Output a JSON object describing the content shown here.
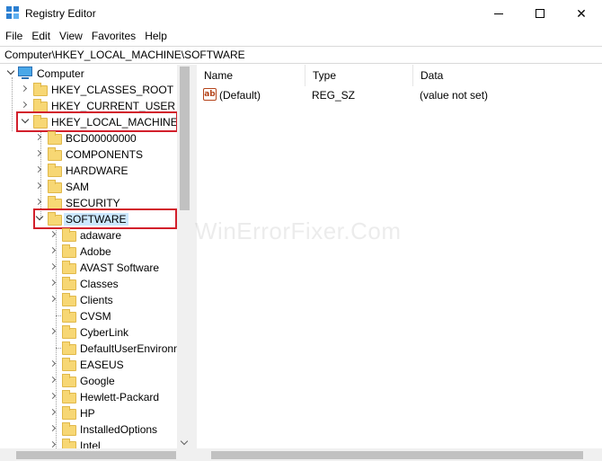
{
  "window": {
    "title": "Registry Editor",
    "icon": "registry-editor-icon",
    "controls": [
      "minimize-icon",
      "maximize-icon",
      "close-icon"
    ],
    "close_glyph": "✕"
  },
  "menu": {
    "items": [
      "File",
      "Edit",
      "View",
      "Favorites",
      "Help"
    ]
  },
  "address": {
    "path": "Computer\\HKEY_LOCAL_MACHINE\\SOFTWARE"
  },
  "tree": {
    "root": "Computer",
    "hives": [
      "HKEY_CLASSES_ROOT",
      "HKEY_CURRENT_USER",
      "HKEY_LOCAL_MACHINE"
    ],
    "hklm_children": [
      "BCD00000000",
      "COMPONENTS",
      "HARDWARE",
      "SAM",
      "SECURITY",
      "SOFTWARE"
    ],
    "software_children": [
      "adaware",
      "Adobe",
      "AVAST Software",
      "Classes",
      "Clients",
      "CVSM",
      "CyberLink",
      "DefaultUserEnvironn",
      "EASEUS",
      "Google",
      "Hewlett-Packard",
      "HP",
      "InstalledOptions",
      "Intel"
    ],
    "selected": "SOFTWARE",
    "highlighted": [
      "HKEY_LOCAL_MACHINE",
      "SOFTWARE"
    ]
  },
  "values_table": {
    "columns": [
      "Name",
      "Type",
      "Data"
    ],
    "rows": [
      {
        "name": "(Default)",
        "type": "REG_SZ",
        "data": "(value not set)",
        "icon": "string-value-icon",
        "icon_text": "ab"
      }
    ]
  },
  "watermark": "WinErrorFixer.Com",
  "colors": {
    "highlight_border": "#d21f2b",
    "selection": "#cce8ff",
    "folder": "#f7d774"
  }
}
